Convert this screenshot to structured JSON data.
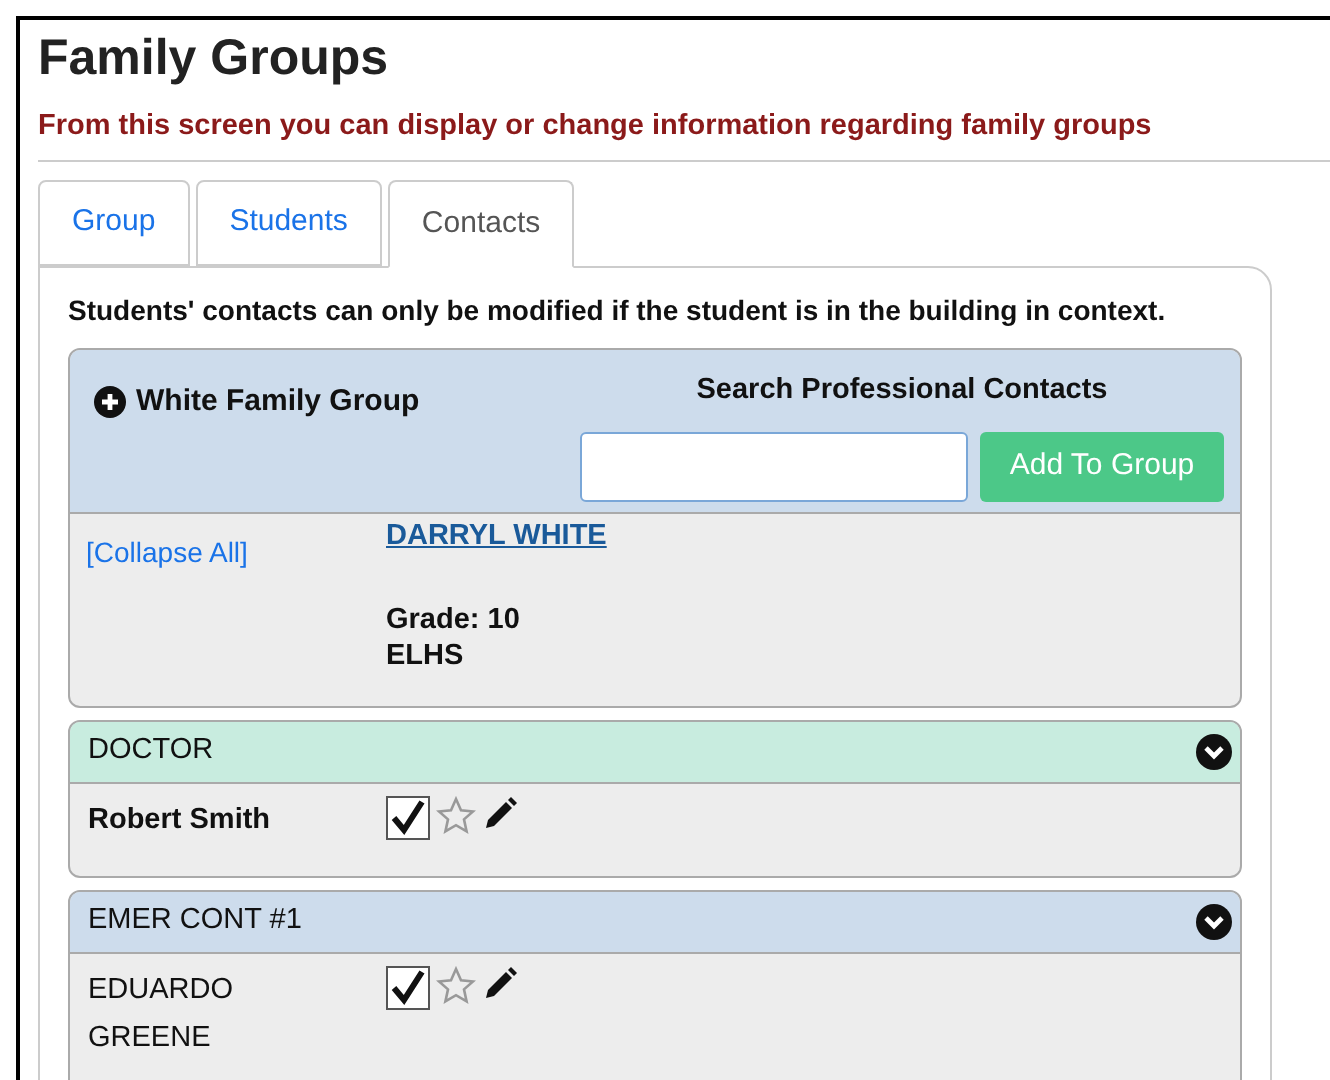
{
  "page": {
    "title": "Family Groups",
    "subtitle": "From this screen you can display or change information regarding family groups"
  },
  "tabs": [
    {
      "label": "Group",
      "selected": false
    },
    {
      "label": "Students",
      "selected": false
    },
    {
      "label": "Contacts",
      "selected": true
    }
  ],
  "notice": "Students' contacts can only be modified if the student is in the building in context.",
  "group": {
    "name": "White Family Group",
    "search_label": "Search Professional Contacts",
    "add_button": "Add To Group",
    "collapse_link": "[Collapse All]",
    "student": {
      "name": "DARRYL WHITE",
      "grade": "Grade: 10",
      "school": "ELHS"
    }
  },
  "contact_types": [
    {
      "title": "DOCTOR",
      "color": "#c8ecdf",
      "contacts": [
        {
          "name": "Robert Smith",
          "bold": true,
          "checked": true,
          "starred": false
        }
      ]
    },
    {
      "title": "EMER CONT #1",
      "color": "#cddcec",
      "contacts": [
        {
          "name": "EDUARDO GREENE",
          "bold": false,
          "checked": true,
          "starred": false
        }
      ]
    }
  ]
}
